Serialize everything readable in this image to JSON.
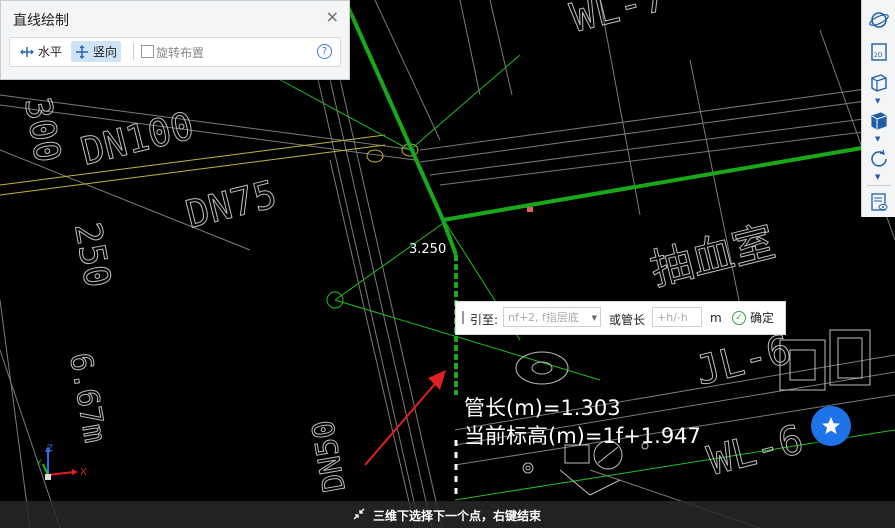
{
  "panel": {
    "title": "直线绘制",
    "close_glyph": "×",
    "mode_horizontal": "水平",
    "mode_vertical": "竖向",
    "rotate_label": "旋转布置",
    "help_glyph": "?",
    "active_mode": "竖向"
  },
  "right_toolbar": {
    "items": [
      {
        "icon": "orbit-icon"
      },
      {
        "icon": "2d-view-icon",
        "label": "2D"
      },
      {
        "icon": "3d-box-icon"
      },
      {
        "icon": "3d-box-filled-icon"
      },
      {
        "icon": "rotate-icon"
      },
      {
        "icon": "layer-properties-icon"
      }
    ]
  },
  "canvas": {
    "elevation_label": "3.250",
    "room_label": "抽血室",
    "labels": [
      "DN100",
      "DN75",
      "DN50",
      "300",
      "250",
      "6.67m",
      "WL-7",
      "JL-6",
      "WL-6"
    ]
  },
  "prompt": {
    "to_label": "引至:",
    "to_placeholder": "nf+2, f指层底",
    "or_label": "或管长",
    "length_placeholder": "+h/-h",
    "unit": "m",
    "confirm": "确定"
  },
  "info": {
    "pipe_length": "管长(m)=1.303",
    "current_elevation": "当前标高(m)=1f+1.947"
  },
  "status": {
    "message": "三维下选择下一个点，右键结束"
  },
  "axis": {
    "x": "X",
    "y": "Y",
    "z": "Z"
  },
  "colors": {
    "pipe_green": "#19a81a",
    "cad_line_green": "#1fbf1f",
    "cad_white": "#bfbfbf",
    "accent_blue": "#1e73e8",
    "arrow_red": "#e02020"
  }
}
